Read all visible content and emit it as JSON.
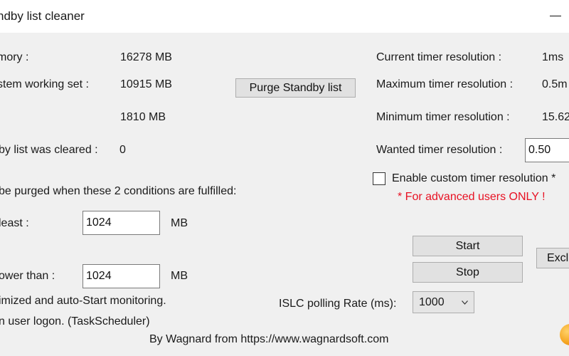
{
  "window": {
    "title": "ndby list cleaner",
    "minimize_glyph": "—"
  },
  "memory": {
    "total_label": "mory :",
    "total_value": "16278 MB",
    "working_set_label": "stem working set :",
    "working_set_value": "10915 MB",
    "free_value": "1810 MB",
    "cleared_label": "by list was cleared :",
    "cleared_value": "0",
    "purge_button": "Purge Standby list"
  },
  "timer": {
    "current_label": "Current timer resolution :",
    "current_value": "1ms",
    "max_label": "Maximum timer resolution :",
    "max_value": "0.5m",
    "min_label": "Minimum timer resolution :",
    "min_value": "15.62",
    "wanted_label": "Wanted timer resolution :",
    "wanted_value": "0.50",
    "custom_checkbox_label": "Enable custom timer resolution *",
    "custom_checkbox_checked": false,
    "advanced_warning": "* For advanced users ONLY !"
  },
  "conditions": {
    "heading": "be purged when these 2 conditions are fulfilled:",
    "least_label": "least :",
    "least_value": "1024",
    "least_unit": "MB",
    "lower_label": "ower than :",
    "lower_value": "1024",
    "lower_unit": "MB",
    "auto_start_text": "imized and auto-Start monitoring.",
    "logon_text": "n user logon. (TaskScheduler)"
  },
  "controls": {
    "start_button": "Start",
    "stop_button": "Stop",
    "exclusions_button": "Exclu",
    "polling_label": "ISLC polling Rate (ms):",
    "polling_value": "1000"
  },
  "footer": {
    "credit": "By Wagnard from https://www.wagnardsoft.com"
  },
  "colors": {
    "warning": "#e81123",
    "button_bg": "#e1e1e1",
    "window_bg": "#f0f0f0"
  }
}
